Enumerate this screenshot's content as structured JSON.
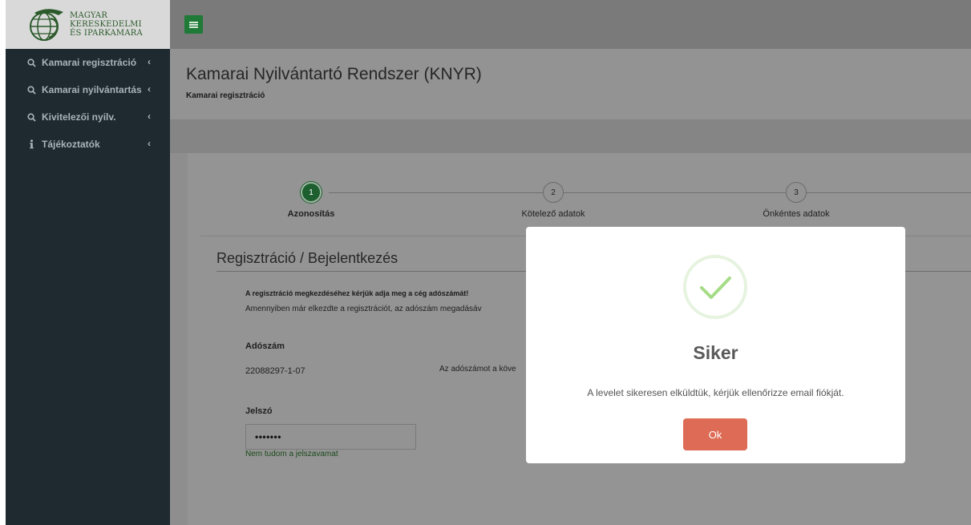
{
  "logo": {
    "line1": "MAGYAR",
    "line2": "KERESKEDELMI",
    "line3": "ÉS IPARKAMARA"
  },
  "sidebar": {
    "items": [
      {
        "icon": "search-icon",
        "label": "Kamarai regisztráció",
        "chevron": "‹"
      },
      {
        "icon": "search-icon",
        "label": "Kamarai nyilvántartás",
        "chevron": "‹"
      },
      {
        "icon": "search-icon",
        "label": "Kivitelezői nyilv.",
        "chevron": "‹"
      },
      {
        "icon": "info-icon",
        "label": "Tájékoztatók",
        "chevron": "‹"
      }
    ]
  },
  "header": {
    "title": "Kamarai Nyilvántartó Rendszer (KNYR)",
    "breadcrumb": "Kamarai regisztráció"
  },
  "steps": [
    {
      "number": "1",
      "label": "Azonosítás",
      "active": true
    },
    {
      "number": "2",
      "label": "Kötelező adatok",
      "active": false
    },
    {
      "number": "3",
      "label": "Önkéntes adatok",
      "active": false
    }
  ],
  "form": {
    "section_title": "Regisztráció / Bejelentkezés",
    "intro_bold": "A regisztráció megkezdéséhez kérjük adja meg a cég adószámát!",
    "intro_text": "Amennyiben már elkezdte a regisztrációt, az adószám megadásáv",
    "tax_label": "Adószám",
    "tax_value": "22088297-1-07",
    "tax_hint": "Az adószámot a köve",
    "password_label": "Jelszó",
    "password_value": "•••••••",
    "forgot_link": "Nem tudom a jelszavamat"
  },
  "modal": {
    "title": "Siker",
    "message": "A levelet sikeresen elküldtük, kérjük ellenőrizze email fiókját.",
    "ok_label": "Ok"
  },
  "colors": {
    "sidebar_bg": "#1e2a30",
    "accent_green": "#1f7a38",
    "ok_button": "#dd6b55",
    "success_check": "#a5dc86"
  }
}
